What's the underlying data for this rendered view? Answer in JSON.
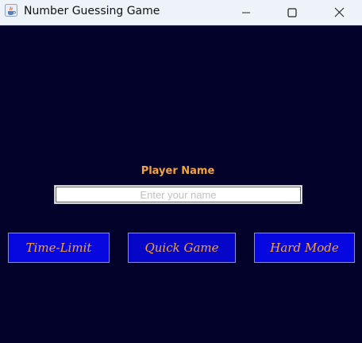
{
  "window": {
    "title": "Number Guessing Game",
    "icon": "java-icon"
  },
  "controls": {
    "minimize_icon": "minimize-icon",
    "maximize_icon": "maximize-icon",
    "close_icon": "close-icon"
  },
  "form": {
    "player_label": "Player Name",
    "name_value": "",
    "name_placeholder": "Enter your name"
  },
  "modes": {
    "time_limit": "Time-Limit",
    "quick_game": "Quick Game",
    "hard_mode": "Hard Mode"
  },
  "colors": {
    "background": "#02022a",
    "button": "#0707e0",
    "accent_text": "#f4a43c",
    "titlebar": "#eef2f9"
  }
}
